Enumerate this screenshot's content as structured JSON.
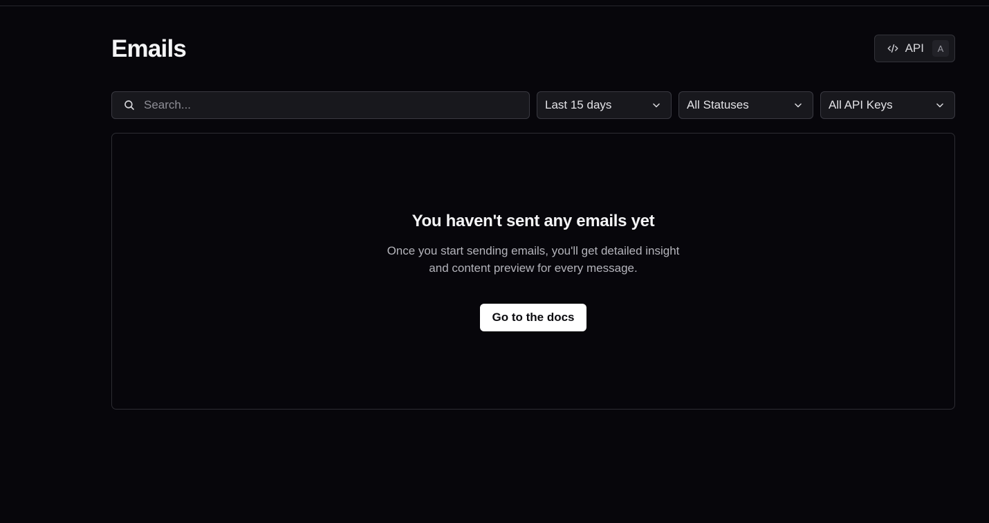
{
  "header": {
    "title": "Emails",
    "api_button": {
      "label": "API",
      "shortcut": "A",
      "icon": "code-icon"
    }
  },
  "filters": {
    "search": {
      "placeholder": "Search...",
      "value": "",
      "icon": "search-icon"
    },
    "date_range": {
      "selected": "Last 15 days",
      "icon": "chevron-down-icon"
    },
    "status": {
      "selected": "All Statuses",
      "icon": "chevron-down-icon"
    },
    "api_keys": {
      "selected": "All API Keys",
      "icon": "chevron-down-icon"
    }
  },
  "empty_state": {
    "title": "You haven't sent any emails yet",
    "description": "Once you start sending emails, you'll get detailed insight and content preview for every message.",
    "cta_label": "Go to the docs"
  },
  "colors": {
    "background": "#07060b",
    "border": "#2d2d33",
    "input_background": "#18181d",
    "primary_button": "#ffffff"
  }
}
